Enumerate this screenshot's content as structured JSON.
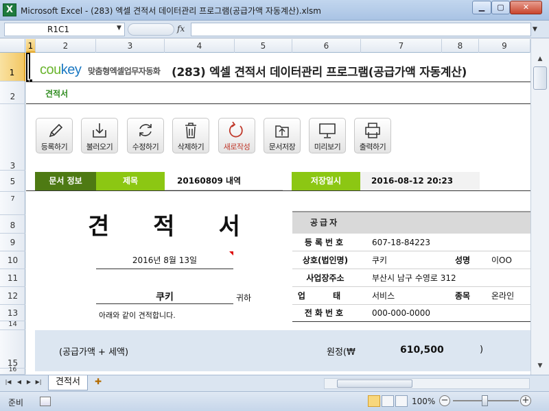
{
  "window": {
    "title": "Microsoft Excel - (283) 엑셀 견적서 데이터관리 프로그램(공급가액 자동계산).xlsm",
    "app_icon": "excel-icon",
    "min_label": "▁",
    "max_label": "▢",
    "close_label": "✕"
  },
  "formula_bar": {
    "name_box": "R1C1",
    "fx_label": "fx",
    "formula": ""
  },
  "columns": [
    "1",
    "2",
    "3",
    "4",
    "5",
    "6",
    "7",
    "8",
    "9"
  ],
  "rows": [
    "1",
    "2",
    "3",
    "5",
    "7",
    "8",
    "9",
    "10",
    "11",
    "12",
    "13",
    "14",
    "15",
    "16"
  ],
  "header": {
    "logo_co": "cou",
    "logo_key": "key",
    "logo_tagline": "맞춤형엑셀업무자동화",
    "title": "(283) 엑셀 견적서 데이터관리 프로그램(공급가액 자동계산)",
    "subtitle": "견적서"
  },
  "toolbar": [
    {
      "label": "등록하기",
      "icon": "pencil-icon"
    },
    {
      "label": "불러오기",
      "icon": "download-icon"
    },
    {
      "label": "수정하기",
      "icon": "refresh-icon"
    },
    {
      "label": "삭제하기",
      "icon": "trash-icon"
    },
    {
      "label": "새로작성",
      "icon": "new-icon"
    },
    {
      "label": "문서저장",
      "icon": "upload-icon"
    },
    {
      "label": "미리보기",
      "icon": "monitor-icon"
    },
    {
      "label": "출력하기",
      "icon": "printer-icon"
    }
  ],
  "info": {
    "doc_info_label": "문서 정보",
    "title_label": "제목",
    "title_value": "20160809 내역",
    "saved_label": "저장일시",
    "saved_value": "2016-08-12 20:23"
  },
  "estimate": {
    "doc_title": [
      "견",
      "적",
      "서"
    ],
    "date": "2016년 8월 13일",
    "client": "쿠키",
    "client_suffix": "귀하",
    "note": "아래와 같이 견적합니다."
  },
  "supplier": {
    "header": "공급자",
    "reg_no_label": "등록번호",
    "reg_no": "607-18-84223",
    "company_label": "상호(법인명)",
    "company": "쿠키",
    "name_label": "성명",
    "name": "이OO",
    "address_label": "사업장주소",
    "address": "부산시 남구 수영로 312",
    "business_label": "업 태",
    "business": "서비스",
    "item_label": "종목",
    "item": "온라인",
    "phone_label": "전화번호",
    "phone": "000-000-0000"
  },
  "total": {
    "label": "(공급가액 + 세액)",
    "won": "원정(₩",
    "amount": "610,500",
    "close": ")"
  },
  "sheet_tabs": {
    "active": "견적서"
  },
  "status": {
    "ready": "준비",
    "zoom": "100%",
    "zoom_out": "−",
    "zoom_in": "+"
  },
  "colors": {
    "dark_green": "#4e7a13",
    "lime_green": "#8cc713",
    "logo_blue": "#1b78c2",
    "logo_green": "#69b42d",
    "total_bg": "#dce6f1"
  }
}
